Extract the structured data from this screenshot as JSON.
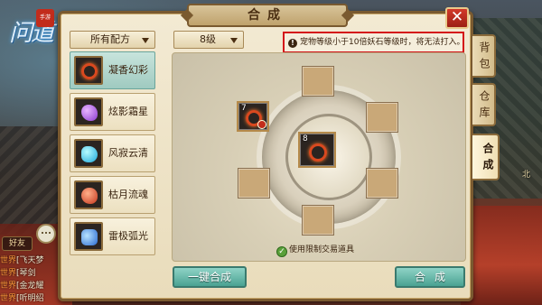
{
  "window": {
    "title": "合成",
    "close_label": "✕"
  },
  "logo": {
    "text": "问道",
    "seal_text": "手游"
  },
  "filters": {
    "recipe_selected": "所有配方",
    "level_selected": "8级"
  },
  "warning": {
    "icon": "!",
    "text": "宠物等级小于10倍妖石等级时，将无法打入。"
  },
  "recipes": [
    {
      "label": "凝香幻彩",
      "gem": "gem-ring",
      "active": true
    },
    {
      "label": "炫影霜星",
      "gem": "gem-purple",
      "active": false
    },
    {
      "label": "风寂云清",
      "gem": "gem-cyan",
      "active": false
    },
    {
      "label": "枯月流魂",
      "gem": "gem-red",
      "active": false
    },
    {
      "label": "雷极弧光",
      "gem": "gem-blue",
      "active": false
    }
  ],
  "slots": {
    "input_filled": {
      "count": "7"
    },
    "center": {
      "count": "8"
    }
  },
  "options": {
    "use_restricted_label": "使用限制交易道具",
    "checked_mark": "✓"
  },
  "buttons": {
    "auto_compose": "一键合成",
    "compose": "合成"
  },
  "tabs": [
    {
      "label": "背包",
      "active": false
    },
    {
      "label": "仓库",
      "active": false
    },
    {
      "label": "合成",
      "active": true
    }
  ],
  "chat": {
    "friend_label": "好友",
    "lines": [
      {
        "tag": "世界",
        "msg": "[飞天梦"
      },
      {
        "tag": "世界",
        "msg": "[琴剑"
      },
      {
        "tag": "世界",
        "msg": "[金龙耀"
      },
      {
        "tag": "世界",
        "msg": "[听明绍"
      }
    ]
  },
  "scene": {
    "right_text": "北"
  },
  "colors": {
    "accent_teal": "#4aa292",
    "warning_border": "#d4141a",
    "close_red": "#c22c1c",
    "panel_bg": "#f3ead3"
  }
}
